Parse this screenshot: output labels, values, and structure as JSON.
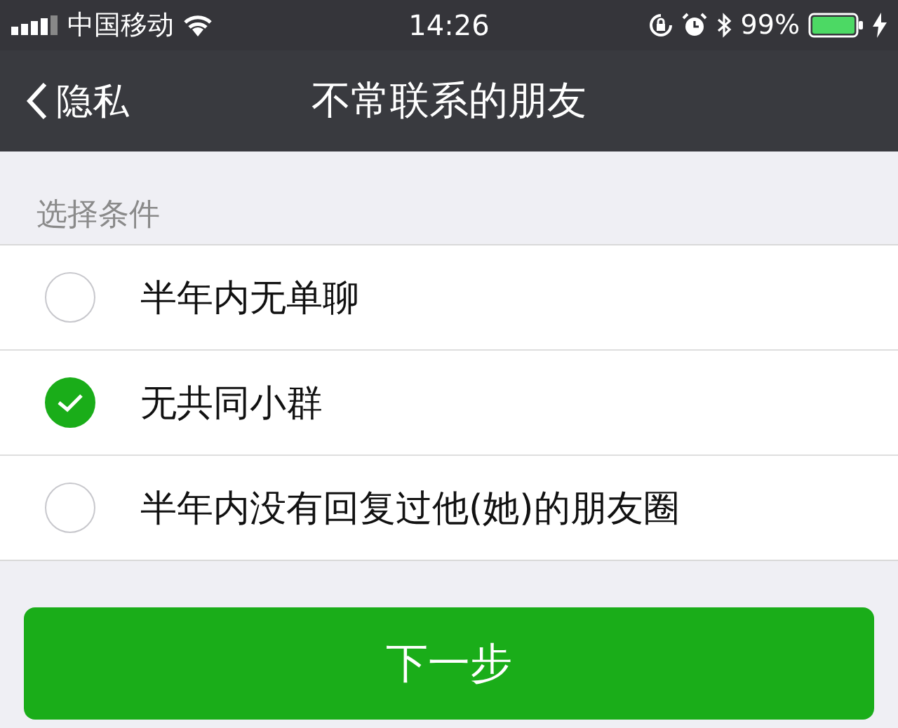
{
  "status_bar": {
    "carrier": "中国移动",
    "time": "14:26",
    "battery": "99%"
  },
  "nav": {
    "back": "隐私",
    "title": "不常联系的朋友"
  },
  "section": {
    "header": "选择条件",
    "options": [
      {
        "label": "半年内无单聊",
        "selected": false
      },
      {
        "label": "无共同小群",
        "selected": true
      },
      {
        "label": "半年内没有回复过他(她)的朋友圈",
        "selected": false
      }
    ]
  },
  "button": {
    "label": "下一步"
  }
}
